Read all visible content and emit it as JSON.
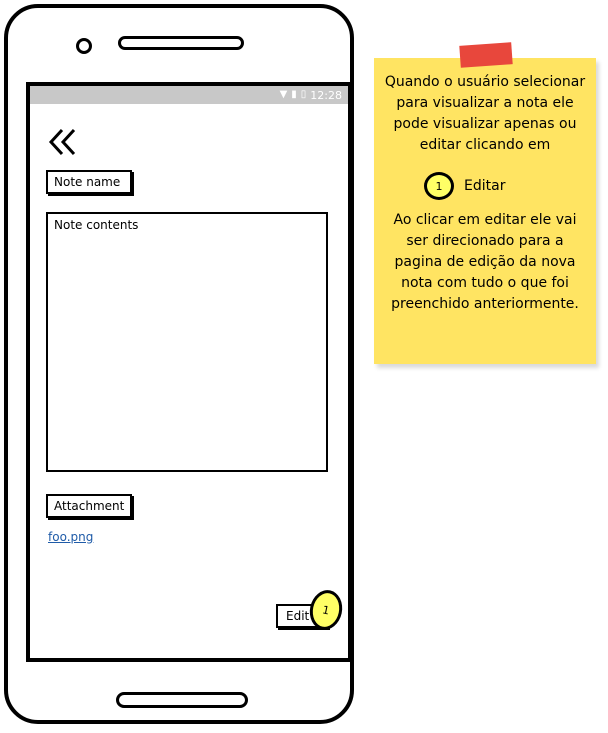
{
  "status_bar": {
    "time": "12:28"
  },
  "screen": {
    "note_name_label": "Note name",
    "note_contents_placeholder": "Note contents",
    "attachment_label": "Attachment",
    "attachment_file": "foo.png",
    "edit_label": "Edit",
    "marker_number": "1"
  },
  "annotation": {
    "paragraph1": "Quando o usuário selecionar para visualizar a nota ele pode visualizar apenas ou editar clicando em",
    "marker_number": "1",
    "marker_label": "Editar",
    "paragraph2": "Ao clicar em editar ele vai ser direcionado para a pagina de edição da nova nota com tudo o que foi preenchido anteriormente.",
    "note_color": "#ffe462",
    "tape_color": "#e8473c"
  }
}
